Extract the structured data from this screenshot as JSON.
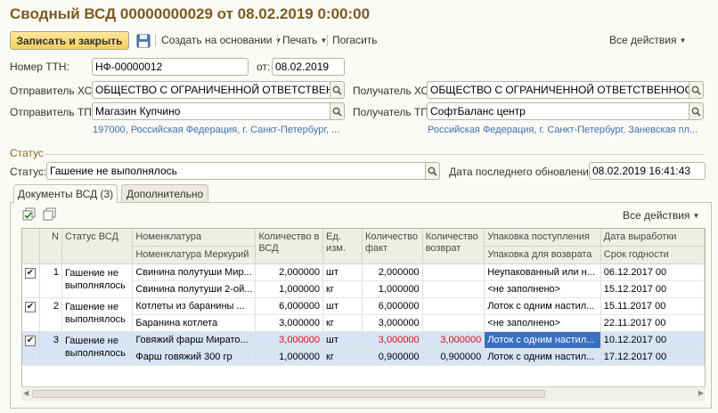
{
  "window": {
    "title": "Сводный ВСД 00000000029 от 08.02.2019 0:00:00"
  },
  "toolbar": {
    "save_close_label": "Записать и закрыть",
    "save_icon": "floppy-disk-icon",
    "create_based_label": "Создать на основании",
    "print_label": "Печать",
    "cancel_label": "Погасить",
    "all_actions_label": "Все действия"
  },
  "form": {
    "ttn_label": "Номер ТТН:",
    "ttn_value": "НФ-00000012",
    "date_label": "от:",
    "date_value": "08.02.2019",
    "sender_hs_label": "Отправитель ХС:",
    "sender_hs_value": "ОБЩЕСТВО С ОГРАНИЧЕННОЙ ОТВЕТСТВЕННОС",
    "receiver_hs_label": "Получатель ХС:",
    "receiver_hs_value": "ОБЩЕСТВО С ОГРАНИЧЕННОЙ ОТВЕТСТВЕННОСТЬЮ",
    "sender_tp_label": "Отправитель ТП:",
    "sender_tp_value": "Магазин Купчино",
    "receiver_tp_label": "Получатель ТП:",
    "receiver_tp_value": "СофтБаланс центр",
    "sender_address": "197000, Российская Федерация, г. Санкт-Петербург, ...",
    "receiver_address": "Российская Федерация, г. Санкт-Петербург, Заневская пл..."
  },
  "status_section": {
    "title": "Статус",
    "status_label": "Статус:",
    "status_value": "Гашение не выполнялось",
    "updated_label": "Дата последнего обновления:",
    "updated_value": "08.02.2019 16:41:43"
  },
  "tabs": [
    {
      "label": "Документы ВСД (3)",
      "active": true
    },
    {
      "label": "Дополнительно",
      "active": false
    }
  ],
  "table_toolbar": {
    "icon_check_all": "check-all-icon",
    "icon_uncheck_all": "uncheck-all-icon",
    "all_actions_label": "Все действия"
  },
  "table": {
    "headers": {
      "n": "N",
      "status": "Статус ВСД",
      "nomenclature": "Номенклатура",
      "nomenclature_mercury": "Номенклатура Меркурий",
      "qty_vsd": "Количество в ВСД",
      "unit": "Ед. изм.",
      "qty_fact": "Количество факт",
      "qty_return": "Количество возврат",
      "pack_in": "Упаковка поступления",
      "pack_return": "Упаковка для возврата",
      "prod_date": "Дата выработки",
      "expiry": "Срок годности"
    },
    "rows": [
      {
        "checked": true,
        "n": "1",
        "status": "Гашение не выполнялось",
        "line1": {
          "nom": "Свинина полутуши Мир...",
          "qty": "2,000000",
          "unit": "шт",
          "fact": "2,000000",
          "ret": "",
          "pack": "Неупакованный или н...",
          "date": "06.12.2017 00"
        },
        "line2": {
          "nom": "Свинина полутуши 2-ой...",
          "qty": "1,000000",
          "unit": "кг",
          "fact": "1,000000",
          "ret": "",
          "pack": "<не заполнено>",
          "date": "15.12.2017 00"
        }
      },
      {
        "checked": true,
        "n": "2",
        "status": "Гашение не выполнялось",
        "line1": {
          "nom": "Котлеты из баранины ...",
          "qty": "6,000000",
          "unit": "шт",
          "fact": "6,000000",
          "ret": "",
          "pack": "Лоток с одним настил...",
          "date": "15.11.2017 00"
        },
        "line2": {
          "nom": "Баранина котлета",
          "qty": "3,000000",
          "unit": "кг",
          "fact": "3,000000",
          "ret": "",
          "pack": "<не заполнено>",
          "date": "22.11.2017 00"
        }
      },
      {
        "checked": true,
        "n": "3",
        "status": "Гашение не выполнялось",
        "line1": {
          "nom": "Говяжий фарш Мирато...",
          "qty": "3,000000",
          "unit": "шт",
          "fact": "3,000000",
          "ret": "3,000000",
          "pack": "Лоток с одним настил...",
          "date": "10.12.2017 00"
        },
        "line2": {
          "nom": "Фарш говяжий 300 гр",
          "qty": "1,000000",
          "unit": "кг",
          "fact": "0,900000",
          "ret": "0,900000",
          "pack": "Лоток с одним настил...",
          "date": "17.12.2017 00"
        }
      }
    ]
  },
  "colors": {
    "title": "#7a5b1f",
    "link": "#3d6fb5",
    "selected_row": "#d6e4f5",
    "focus_cell": "#3a6fc2",
    "mismatch": "#d11111"
  }
}
